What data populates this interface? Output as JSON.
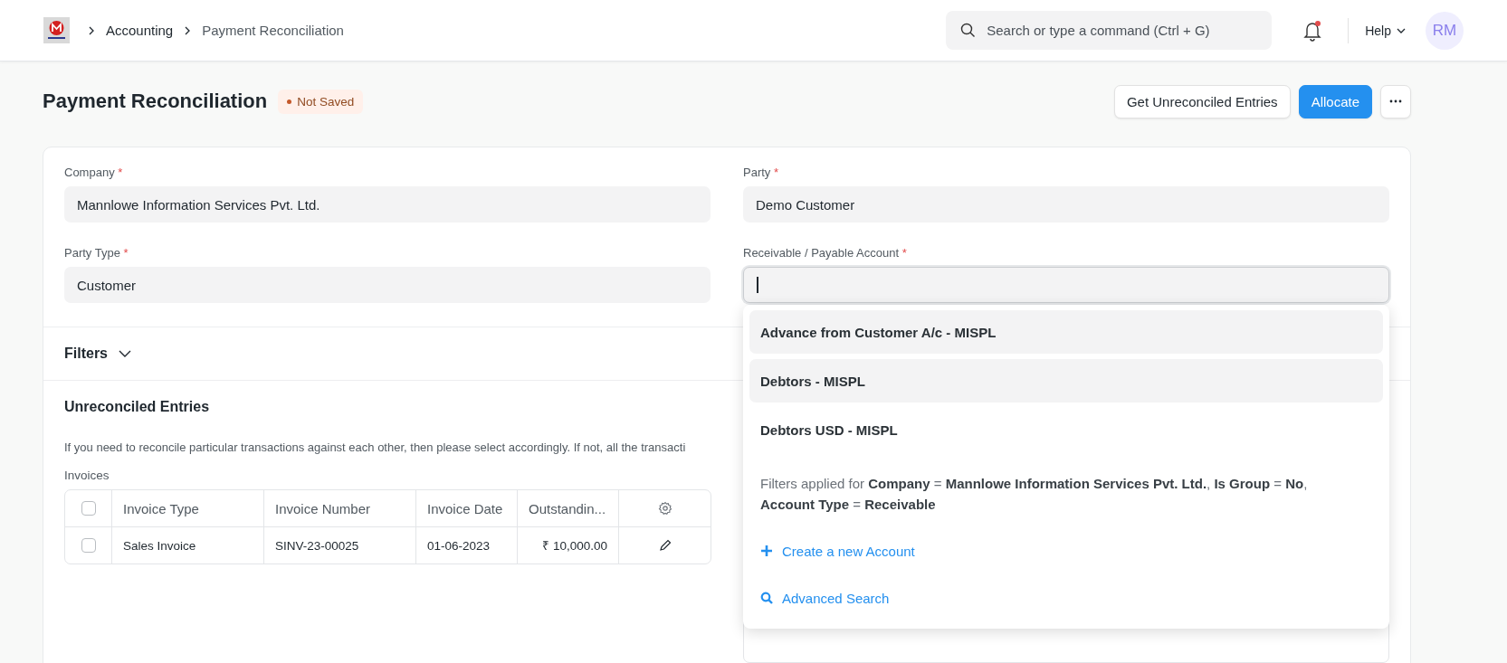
{
  "breadcrumbs": [
    {
      "label": "Accounting",
      "current": false
    },
    {
      "label": "Payment Reconciliation",
      "current": true
    }
  ],
  "search": {
    "placeholder": "Search or type a command (Ctrl + G)"
  },
  "notifications": {
    "unread": true
  },
  "help": "Help",
  "avatar": "RM",
  "page": {
    "title": "Payment Reconciliation",
    "status": "Not Saved",
    "buttons": [
      {
        "label": "Get Unreconciled Entries",
        "kind": "default"
      },
      {
        "label": "Allocate",
        "kind": "primary"
      },
      {
        "kind": "menu"
      }
    ]
  },
  "fields": [
    {
      "label": "Company",
      "required_mark": "*",
      "value": "Mannlowe Information Services Pvt. Ltd.",
      "focused": false
    },
    {
      "label": "Party",
      "required_mark": "*",
      "value": "Demo Customer",
      "focused": false
    },
    {
      "label": "Party Type",
      "required_mark": "*",
      "value": "Customer",
      "focused": false
    },
    {
      "label": "Receivable / Payable Account",
      "required_mark": "*",
      "focused": true
    }
  ],
  "filters": {
    "label": "Filters",
    "expanded": false
  },
  "unreconciled": {
    "title": "Unreconciled Entries",
    "description": "If you need to reconcile particular transactions against each other, then please select accordingly. If not, all the transacti",
    "invoices": {
      "label": "Invoices",
      "all_checked": false,
      "columns": [
        "Invoice Type",
        "Invoice Number",
        "Invoice Date",
        "Outstandin..."
      ],
      "rows": [
        {
          "checked": false,
          "cells": [
            "Sales Invoice",
            "SINV-23-00025",
            "01-06-2023",
            "₹ 10,000.00"
          ]
        }
      ]
    }
  },
  "dropdown": {
    "options": [
      {
        "label": "Advance from Customer A/c - MISPL",
        "highlighted": true
      },
      {
        "label": "Debtors - MISPL",
        "highlighted": true
      },
      {
        "label": "Debtors USD - MISPL",
        "highlighted": false
      }
    ],
    "filter_note": "Filters applied for **Company** = **Mannlowe Information Services Pvt. Ltd.**, **Is Group** = **No**, **Account Type** = **Receivable**",
    "actions": [
      {
        "label": "Create a new Account",
        "kind": "create"
      },
      {
        "label": "Advanced Search",
        "kind": "search"
      }
    ]
  }
}
